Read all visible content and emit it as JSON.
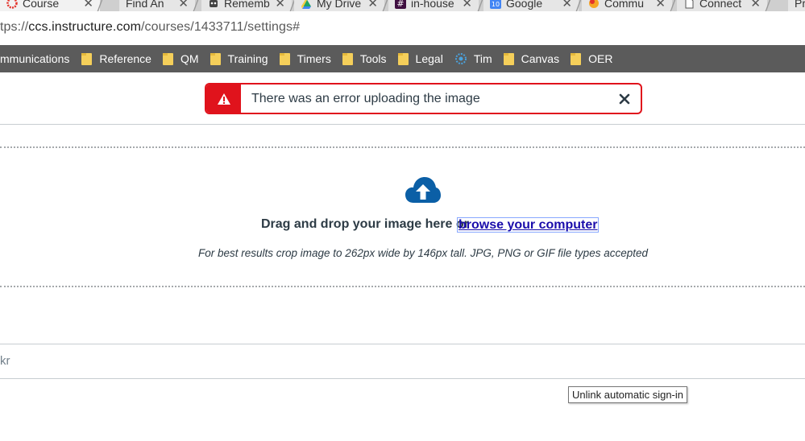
{
  "browser": {
    "tabs": [
      {
        "title": "Course",
        "icon": "canvas-logo-icon",
        "active": true
      },
      {
        "title": "Find An",
        "icon": "none"
      },
      {
        "title": "Rememb",
        "icon": "robot-icon"
      },
      {
        "title": "My Drive",
        "icon": "google-drive-icon"
      },
      {
        "title": "in-house",
        "icon": "slack-icon"
      },
      {
        "title": "Google",
        "icon": "google-calendar-icon"
      },
      {
        "title": "Commu",
        "icon": "community-icon"
      },
      {
        "title": "Connect",
        "icon": "page-icon"
      },
      {
        "title": "Pr",
        "icon": "none"
      }
    ],
    "close_glyph": "✕",
    "url_prefix": "tps://",
    "url_host": "ccs.instructure.com",
    "url_path": "/courses/1433711/settings#"
  },
  "bookmarks": [
    {
      "label": "mmunications",
      "icon": "none"
    },
    {
      "label": "Reference",
      "icon": "folder-icon"
    },
    {
      "label": "QM",
      "icon": "folder-icon"
    },
    {
      "label": "Training",
      "icon": "folder-icon"
    },
    {
      "label": "Timers",
      "icon": "folder-icon"
    },
    {
      "label": "Tools",
      "icon": "folder-icon"
    },
    {
      "label": "Legal",
      "icon": "folder-icon"
    },
    {
      "label": "Tim",
      "icon": "gear-site-icon"
    },
    {
      "label": "Canvas",
      "icon": "folder-icon"
    },
    {
      "label": "OER",
      "icon": "folder-icon"
    }
  ],
  "alert": {
    "message": "There was an error uploading the image",
    "icon": "warning-icon",
    "close_icon": "close-icon"
  },
  "upload": {
    "icon": "cloud-upload-icon",
    "drop_text": "Drag and drop your image here or",
    "browse_link": "browse your computer",
    "hint": "For best results crop image to 262px wide by 146px tall. JPG, PNG or GIF file types accepted"
  },
  "partial_field_text": "kr",
  "tooltip": "Unlink automatic sign-in",
  "colors": {
    "error_red": "#e0131c",
    "brand_blue": "#0b5fa6",
    "bookmark_bar": "#5b5b5b",
    "folder_yellow": "#f5cf5a"
  }
}
